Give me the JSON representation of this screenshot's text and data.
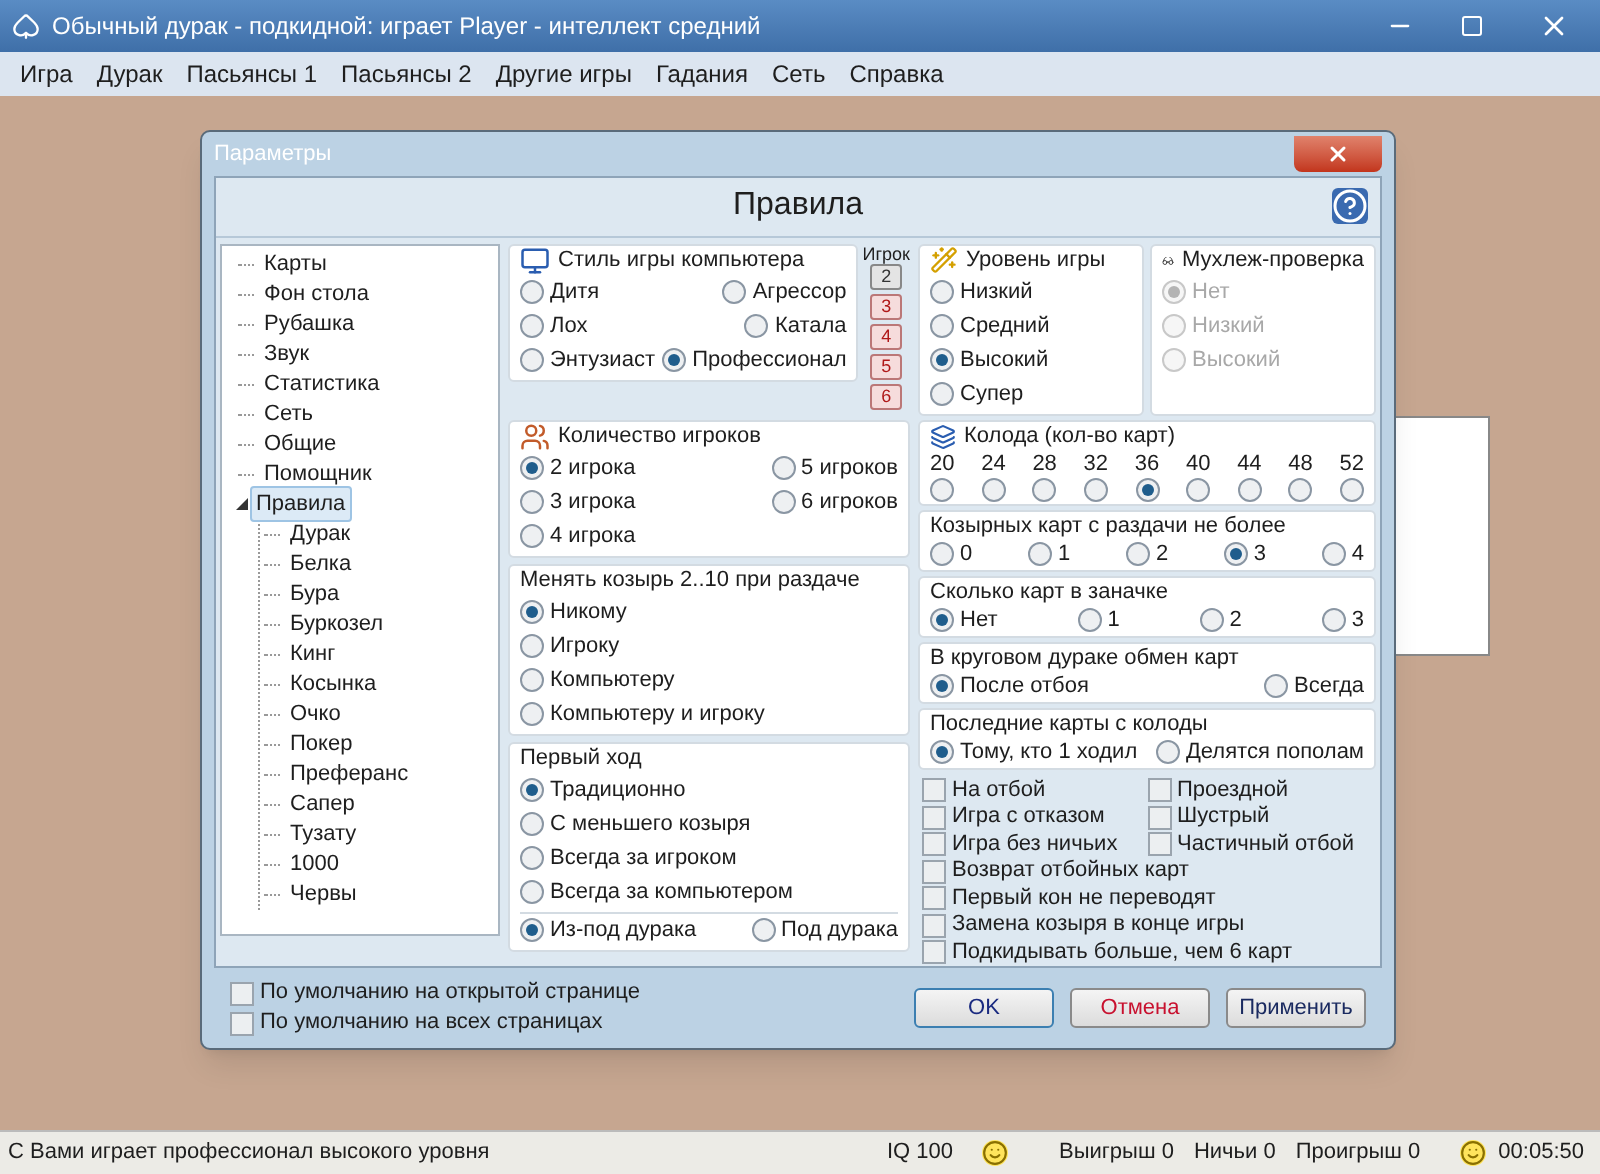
{
  "window": {
    "title": "Обычный дурак - подкидной: играет Player - интеллект средний"
  },
  "menu": [
    "Игра",
    "Дурак",
    "Пасьянсы 1",
    "Пасьянсы 2",
    "Другие игры",
    "Гадания",
    "Сеть",
    "Справка"
  ],
  "dialog": {
    "title": "Параметры",
    "heading": "Правила",
    "tree": [
      {
        "label": "Карты",
        "selected": false
      },
      {
        "label": "Фон стола",
        "selected": false
      },
      {
        "label": "Рубашка",
        "selected": false
      },
      {
        "label": "Звук",
        "selected": false
      },
      {
        "label": "Статистика",
        "selected": false
      },
      {
        "label": "Сеть",
        "selected": false
      },
      {
        "label": "Общие",
        "selected": false
      },
      {
        "label": "Помощник",
        "selected": false
      },
      {
        "label": "Правила",
        "selected": true,
        "expanded": true,
        "children": [
          {
            "label": "Дурак",
            "selected": false
          },
          {
            "label": "Белка",
            "selected": false
          },
          {
            "label": "Бура",
            "selected": false
          },
          {
            "label": "Буркозел",
            "selected": false
          },
          {
            "label": "Кинг",
            "selected": false
          },
          {
            "label": "Косынка",
            "selected": false
          },
          {
            "label": "Очко",
            "selected": false
          },
          {
            "label": "Покер",
            "selected": false
          },
          {
            "label": "Преферанс",
            "selected": false
          },
          {
            "label": "Сапер",
            "selected": false
          },
          {
            "label": "Тузату",
            "selected": false
          },
          {
            "label": "1000",
            "selected": false
          },
          {
            "label": "Червы",
            "selected": false
          }
        ]
      }
    ],
    "player_label": "Игрок",
    "player_buttons": [
      {
        "label": "2",
        "selected": true
      },
      {
        "label": "3",
        "selected": false
      },
      {
        "label": "4",
        "selected": false
      },
      {
        "label": "5",
        "selected": false
      },
      {
        "label": "6",
        "selected": false
      }
    ],
    "middle": [
      {
        "kind": "radio",
        "title": "Стиль игры компьютера",
        "rows": [
          [
            {
              "label": "Дитя",
              "selected": false
            },
            {
              "label": "Агрессор",
              "selected": false
            }
          ],
          [
            {
              "label": "Лох",
              "selected": false
            },
            {
              "label": "Катала",
              "selected": false
            }
          ],
          [
            {
              "label": "Энтузиаст",
              "selected": false
            },
            {
              "label": "Профессионал",
              "selected": true
            }
          ]
        ]
      },
      {
        "kind": "radio",
        "title": "Количество игроков",
        "rows": [
          [
            {
              "label": "2 игрока",
              "selected": true
            },
            {
              "label": "5 игроков",
              "selected": false
            }
          ],
          [
            {
              "label": "3 игрока",
              "selected": false
            },
            {
              "label": "6 игроков",
              "selected": false
            }
          ],
          [
            {
              "label": "4 игрока",
              "selected": false
            }
          ]
        ]
      },
      {
        "kind": "radio",
        "title": "Менять козырь 2..10 при раздаче",
        "rows": [
          [
            {
              "label": "Никому",
              "selected": true
            }
          ],
          [
            {
              "label": "Игроку",
              "selected": false
            }
          ],
          [
            {
              "label": "Компьютеру",
              "selected": false
            }
          ],
          [
            {
              "label": "Компьютеру и игроку",
              "selected": false
            }
          ]
        ]
      },
      {
        "kind": "radio",
        "title": "Первый ход",
        "rows": [
          [
            {
              "label": "Традиционно",
              "selected": true
            }
          ],
          [
            {
              "label": "С меньшего козыря",
              "selected": false
            }
          ],
          [
            {
              "label": "Всегда за игроком",
              "selected": false
            }
          ],
          [
            {
              "label": "Всегда за компьютером",
              "selected": false
            }
          ]
        ],
        "extra_rows": [
          [
            {
              "label": "Из-под дурака",
              "selected": true
            },
            {
              "label": "Под дурака",
              "selected": false
            }
          ]
        ]
      }
    ],
    "right_top": [
      {
        "kind": "radio",
        "title": "Уровень игры",
        "rows": [
          [
            {
              "label": "Низкий",
              "selected": false
            }
          ],
          [
            {
              "label": "Средний",
              "selected": false
            }
          ],
          [
            {
              "label": "Высокий",
              "selected": true
            }
          ],
          [
            {
              "label": "Супер",
              "selected": false
            }
          ]
        ]
      },
      {
        "kind": "radio",
        "title": "Мухлеж-проверка",
        "rows": [
          [
            {
              "label": "Нет",
              "selected": true,
              "disabled": true
            }
          ],
          [
            {
              "label": "Низкий",
              "selected": false,
              "disabled": true
            }
          ],
          [
            {
              "label": "Высокий",
              "selected": false,
              "disabled": true
            }
          ]
        ]
      }
    ],
    "right": [
      {
        "kind": "stacked",
        "title": "Колода (кол-во карт)",
        "rows": [
          [
            {
              "label": "20",
              "selected": false
            },
            {
              "label": "24",
              "selected": false
            },
            {
              "label": "28",
              "selected": false
            },
            {
              "label": "32",
              "selected": false
            },
            {
              "label": "36",
              "selected": true
            },
            {
              "label": "40",
              "selected": false
            },
            {
              "label": "44",
              "selected": false
            },
            {
              "label": "48",
              "selected": false
            },
            {
              "label": "52",
              "selected": false
            }
          ]
        ]
      },
      {
        "kind": "radio",
        "title": "Козырных карт с раздачи не более",
        "rows": [
          [
            {
              "label": "0",
              "selected": false
            },
            {
              "label": "1",
              "selected": false
            },
            {
              "label": "2",
              "selected": false
            },
            {
              "label": "3",
              "selected": true
            },
            {
              "label": "4",
              "selected": false
            }
          ]
        ]
      },
      {
        "kind": "radio",
        "title": "Сколько карт в заначке",
        "rows": [
          [
            {
              "label": "Нет",
              "selected": true
            },
            {
              "label": "1",
              "selected": false
            },
            {
              "label": "2",
              "selected": false
            },
            {
              "label": "3",
              "selected": false
            }
          ]
        ]
      },
      {
        "kind": "radio",
        "title": "В круговом дураке обмен карт",
        "rows": [
          [
            {
              "label": "После отбоя",
              "selected": true
            },
            {
              "label": "Всегда",
              "selected": false
            }
          ]
        ]
      },
      {
        "kind": "radio",
        "title": "Последние карты с колоды",
        "rows": [
          [
            {
              "label": "Тому, кто 1 ходил",
              "selected": true
            },
            {
              "label": "Делятся пополам",
              "selected": false
            }
          ]
        ]
      }
    ],
    "checkbox_rows": [
      [
        {
          "label": "На отбой",
          "checked": false
        },
        {
          "label": "Проездной",
          "checked": false
        }
      ],
      [
        {
          "label": "Игра с отказом",
          "checked": false
        },
        {
          "label": "Шустрый",
          "checked": false
        }
      ],
      [
        {
          "label": "Игра без ничьих",
          "checked": false
        },
        {
          "label": "Частичный отбой",
          "checked": false
        }
      ],
      [
        {
          "label": "Возврат отбойных карт",
          "checked": false
        }
      ],
      [
        {
          "label": "Первый кон не переводят",
          "checked": false
        }
      ],
      [
        {
          "label": "Замена козыря в конце игры",
          "checked": false
        }
      ],
      [
        {
          "label": "Подкидывать больше, чем 6 карт",
          "checked": false
        }
      ]
    ],
    "defaults": [
      {
        "label": "По умолчанию на открытой странице",
        "checked": false
      },
      {
        "label": "По умолчанию на всех страницах",
        "checked": false
      }
    ],
    "buttons": [
      {
        "label": "OK",
        "kind": "default"
      },
      {
        "label": "Отмена",
        "kind": "cancel"
      },
      {
        "label": "Применить",
        "kind": "normal"
      }
    ]
  },
  "status_bar": {
    "message": "С Вами играет профессионал высокого уровня",
    "iq": "IQ 100",
    "wins": "Выигрыш 0",
    "draws": "Ничьи 0",
    "losses": "Проигрыш 0",
    "time": "00:05:50"
  }
}
